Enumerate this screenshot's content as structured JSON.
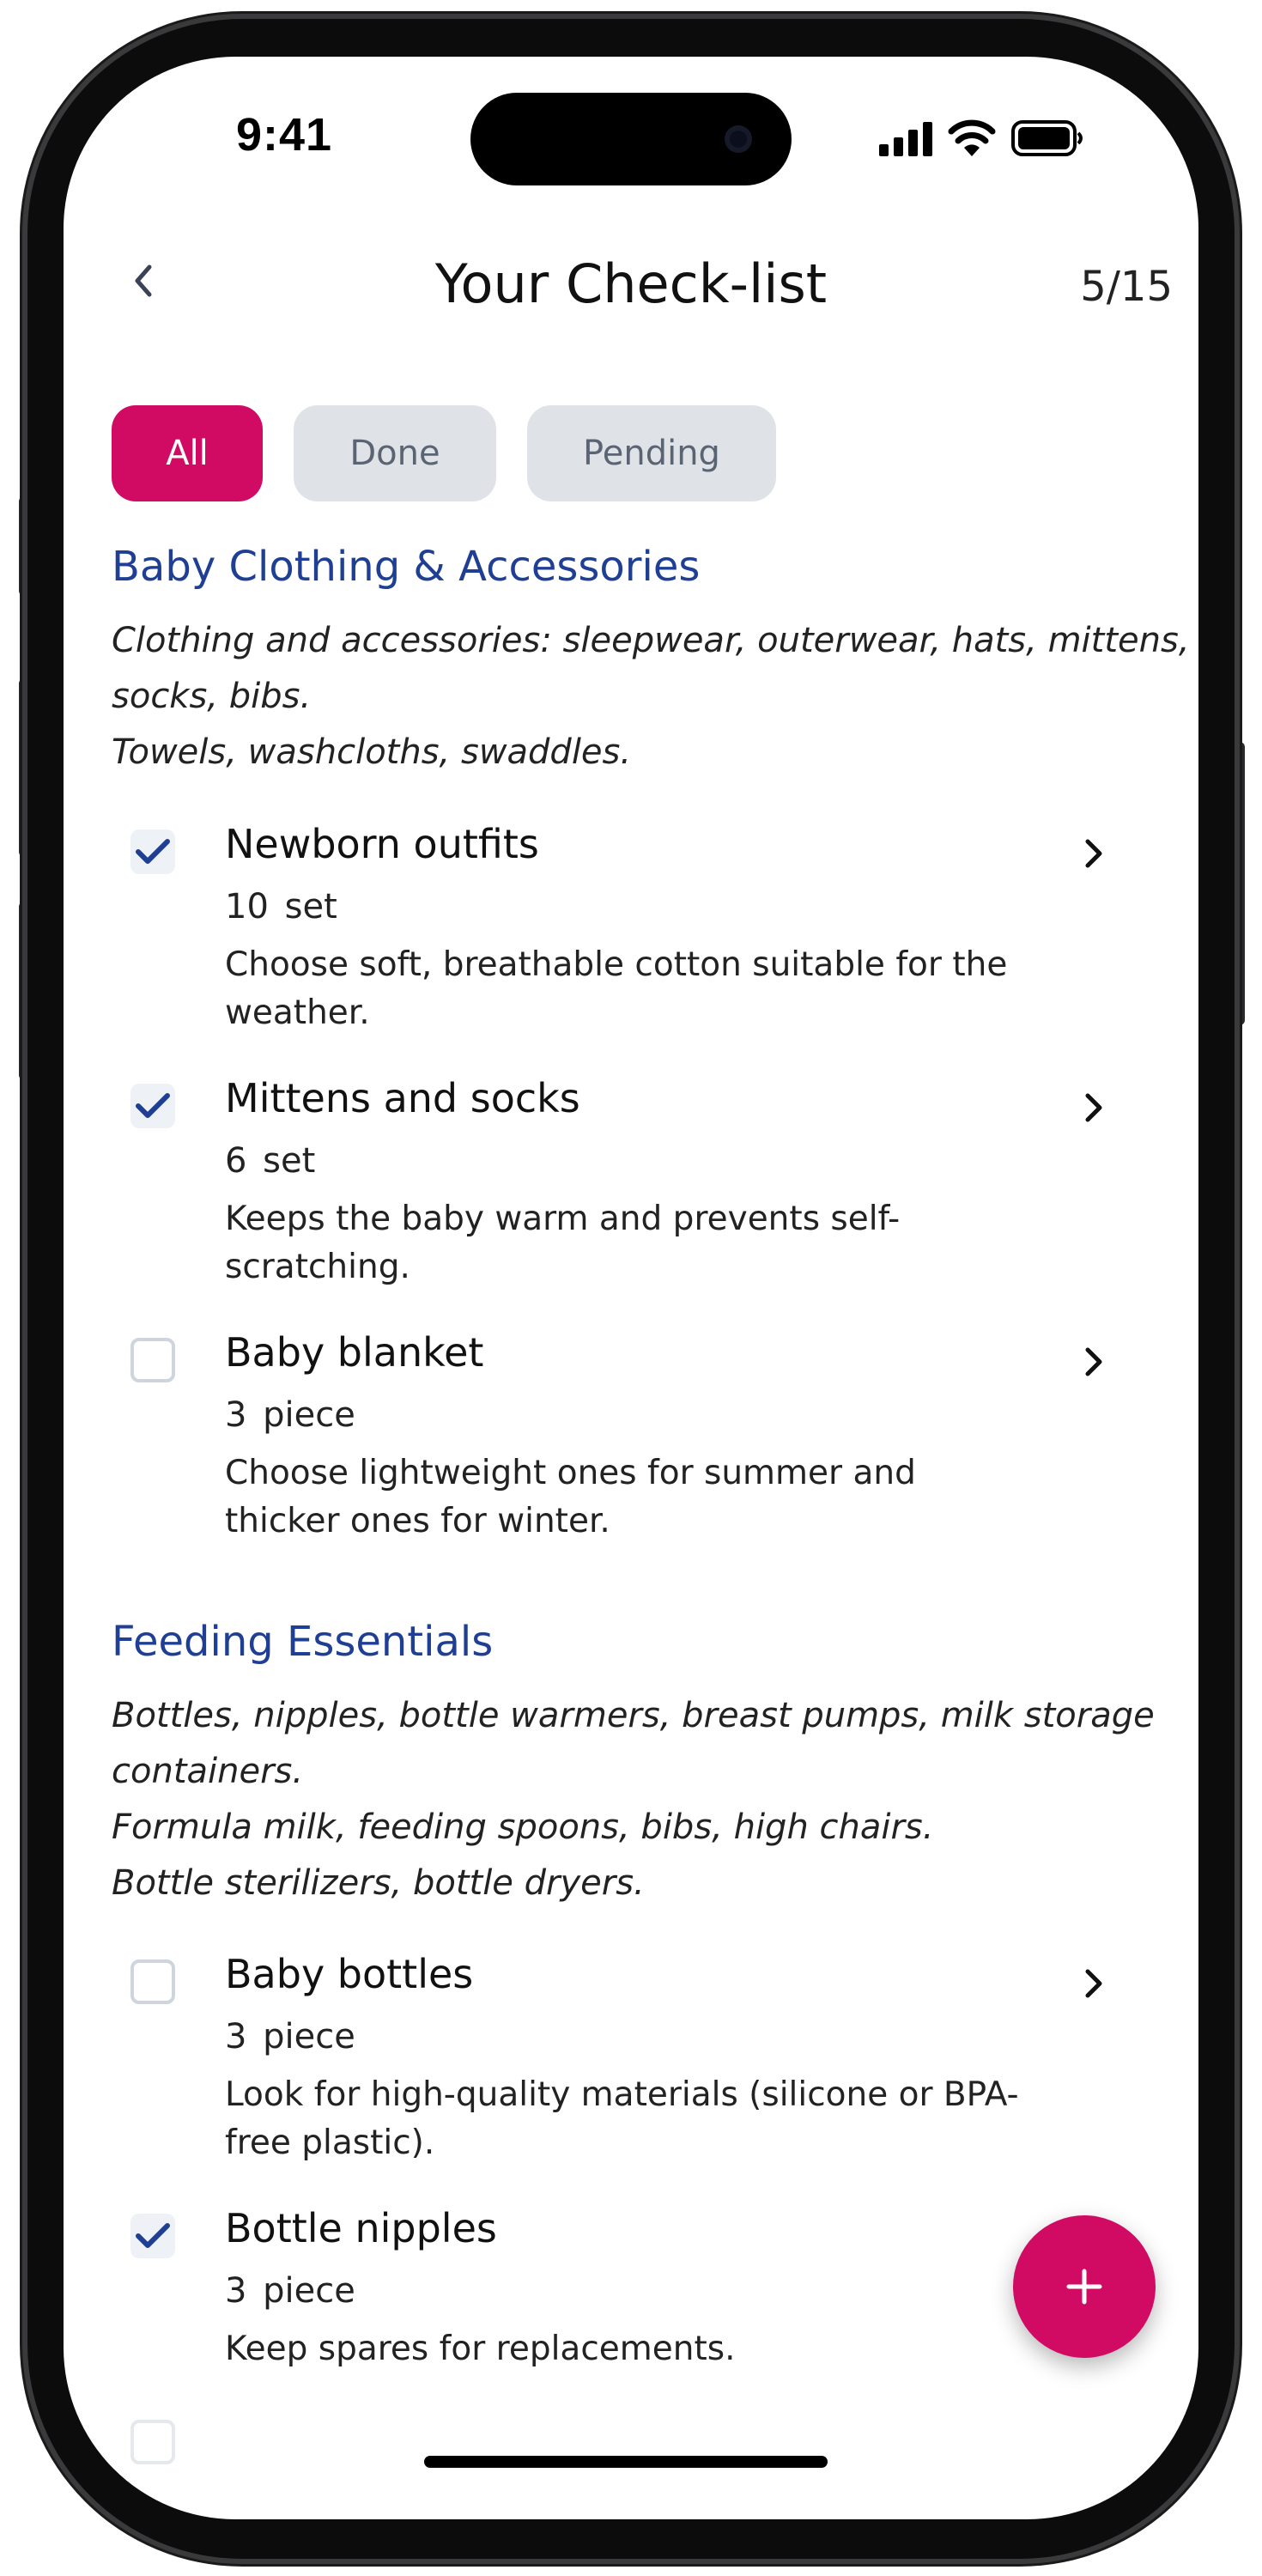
{
  "status_bar": {
    "time": "9:41"
  },
  "header": {
    "title": "Your Check-list",
    "progress": "5/15"
  },
  "tabs": [
    {
      "label": "All",
      "active": true
    },
    {
      "label": "Done",
      "active": false
    },
    {
      "label": "Pending",
      "active": false
    }
  ],
  "sections": [
    {
      "title": "Baby Clothing & Accessories",
      "description": [
        "Clothing and accessories: sleepwear, outerwear, hats, mittens,",
        "socks, bibs.",
        "Towels, washcloths, swaddles."
      ],
      "items": [
        {
          "name": "Newborn outfits",
          "quantity": "10 set",
          "checked": true,
          "note": [
            "Choose soft, breathable cotton suitable for the",
            "weather."
          ]
        },
        {
          "name": "Mittens and socks",
          "quantity": "6 set",
          "checked": true,
          "note": [
            "Keeps the baby warm and prevents self-",
            "scratching."
          ]
        },
        {
          "name": "Baby blanket",
          "quantity": "3 piece",
          "checked": false,
          "note": [
            "Choose lightweight ones for summer and",
            "thicker ones for winter."
          ]
        }
      ]
    },
    {
      "title": "Feeding Essentials",
      "description": [
        "Bottles, nipples, bottle warmers, breast pumps, milk storage",
        "containers.",
        "Formula milk, feeding spoons, bibs, high chairs.",
        "Bottle sterilizers, bottle dryers."
      ],
      "items": [
        {
          "name": "Baby bottles",
          "quantity": "3 piece",
          "checked": false,
          "note": [
            "Look for high-quality materials (silicone or BPA-",
            "free plastic)."
          ]
        },
        {
          "name": "Bottle nipples",
          "quantity": "3 piece",
          "checked": true,
          "note": [
            "Keep spares for replacements."
          ]
        }
      ]
    }
  ],
  "colors": {
    "accent": "#d10b63",
    "section_title": "#1f3f94",
    "check": "#1f3f94",
    "tab_inactive_bg": "#dfe3e8"
  },
  "icons": {
    "back": "chevron-left-icon",
    "item_detail": "chevron-right-icon",
    "add": "plus-icon",
    "check": "checkmark-icon"
  }
}
